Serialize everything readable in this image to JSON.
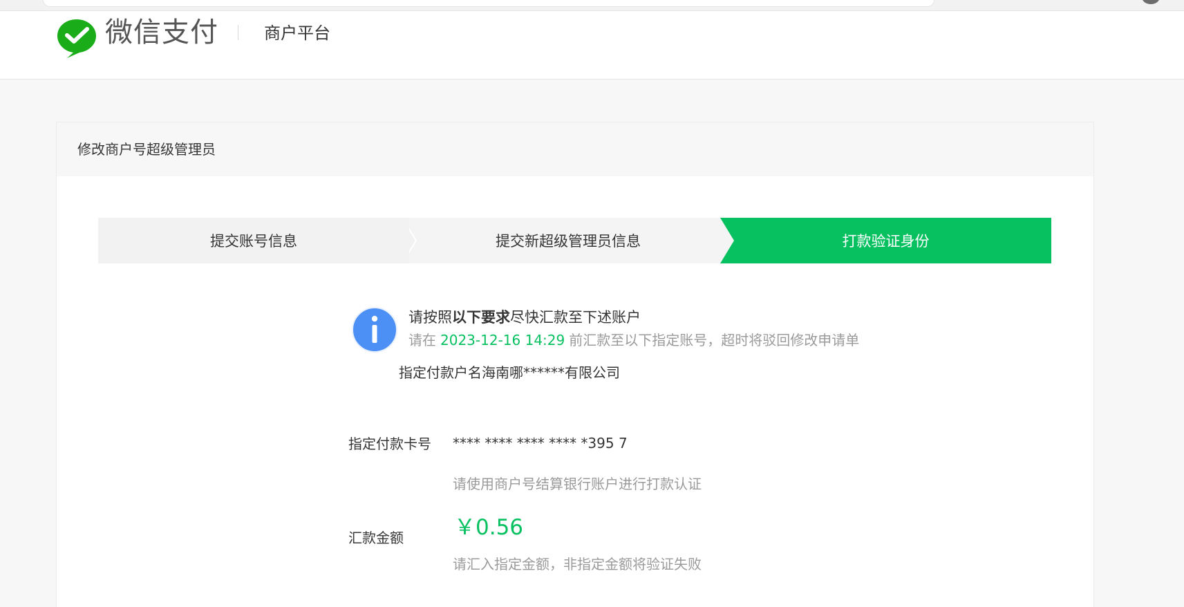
{
  "header": {
    "brand": "微信支付",
    "subtitle": "商户平台"
  },
  "panel": {
    "title": "修改商户号超级管理员"
  },
  "steps": [
    {
      "label": "提交账号信息",
      "state": "done"
    },
    {
      "label": "提交新超级管理员信息",
      "state": "done"
    },
    {
      "label": "打款验证身份",
      "state": "active"
    }
  ],
  "notice": {
    "main_prefix": "请按照",
    "main_bold": "以下要求",
    "main_suffix": "尽快汇款至下述账户",
    "sub_prefix": "请在",
    "deadline": "2023-12-16 14:29",
    "sub_suffix": "前汇款至以下指定账号，超时将驳回修改申请单"
  },
  "payee": "指定付款户名海南哪******有限公司",
  "card": {
    "label": "指定付款卡号",
    "value": "**** **** **** **** *395 7",
    "hint": "请使用商户号结算银行账户进行打款认证"
  },
  "amount": {
    "label": "汇款金额",
    "value": "￥0.56",
    "hint": "请汇入指定金额，非指定金额将验证失败"
  },
  "colors": {
    "accent": "#07c160",
    "info": "#4c8ff5",
    "muted": "#9a9a9a"
  }
}
